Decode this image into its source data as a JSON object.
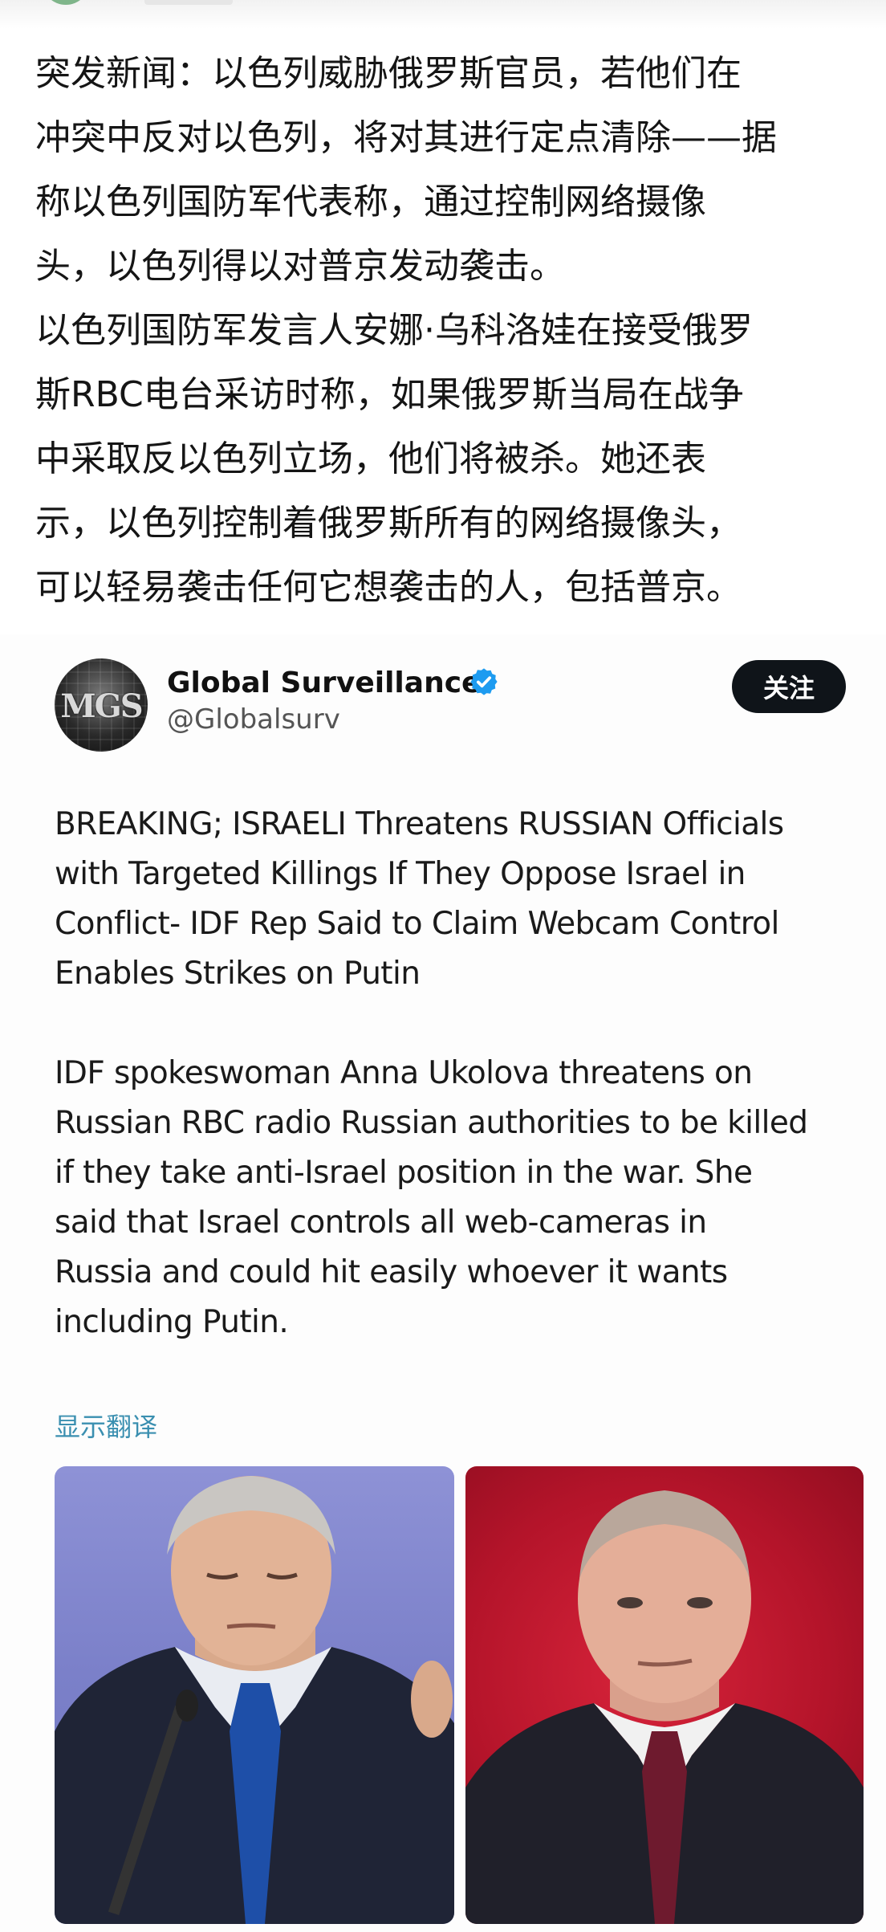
{
  "post": {
    "paragraph_1": "突发新闻：以色列威胁俄罗斯官员，若他们在\n冲突中反对以色列，将对其进行定点清除——据\n称以色列国防军代表称，通过控制网络摄像\n头，以色列得以对普京发动袭击。",
    "paragraph_2": "以色列国防军发言人安娜·乌科洛娃在接受俄罗\n斯RBC电台采访时称，如果俄罗斯当局在战争\n中采取反以色列立场，他们将被杀。她还表\n示，以色列控制着俄罗斯所有的网络摄像头，\n可以轻易袭击任何它想袭击的人，包括普京。"
  },
  "tweet": {
    "avatar_text": "MGS",
    "display_name": "Global Surveillance",
    "handle": "@Globalsurv",
    "follow_label": "关注",
    "verified_icon": "verified-badge-icon",
    "body_1": "BREAKING; ISRAELI Threatens RUSSIAN Officials\nwith Targeted Killings If They Oppose Israel in\nConflict- IDF Rep Said to Claim Webcam Control\nEnables Strikes on Putin",
    "body_2": "IDF spokeswoman Anna Ukolova threatens on\nRussian RBC radio Russian authorities to be killed\nif they take anti-Israel position in the war. She\nsaid that Israel controls all web-cameras in\nRussia and could hit easily whoever  it wants\nincluding Putin.",
    "translate_label": "显示翻译"
  },
  "colors": {
    "verified_blue": "#1d9bf0",
    "follow_bg": "#0f1419",
    "translate_link": "#3a8fb0",
    "photo_left_bg": "#7b80c9",
    "photo_right_bg": "#b4142a"
  }
}
